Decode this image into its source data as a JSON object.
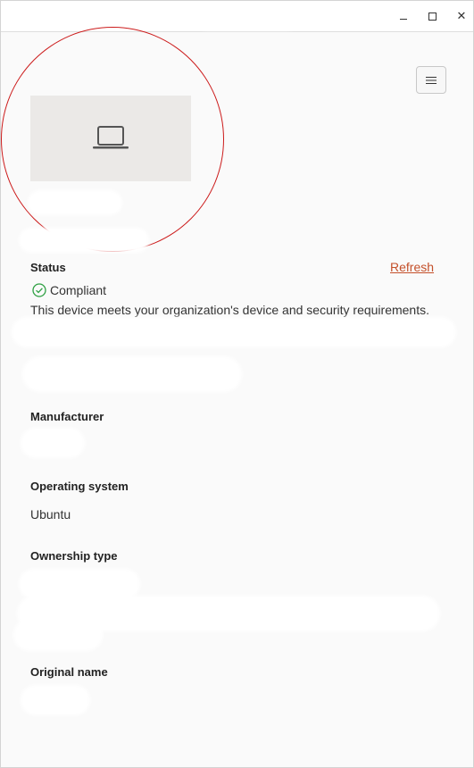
{
  "window_controls": {
    "minimize": "minimize",
    "maximize": "maximize",
    "close": "✕"
  },
  "menu": {
    "icon": "hamburger-menu-icon"
  },
  "device": {
    "icon": "laptop-icon"
  },
  "status": {
    "label": "Status",
    "refresh_label": "Refresh",
    "value": "Compliant",
    "description": "This device meets your organization's device and security requirements.",
    "icon_color": "#2ea043"
  },
  "manufacturer": {
    "label": "Manufacturer"
  },
  "operating_system": {
    "label": "Operating system",
    "value": "Ubuntu"
  },
  "ownership_type": {
    "label": "Ownership type"
  },
  "original_name": {
    "label": "Original name"
  },
  "colors": {
    "accent_link": "#c4502a",
    "highlight_ring": "#cc1b1b"
  }
}
